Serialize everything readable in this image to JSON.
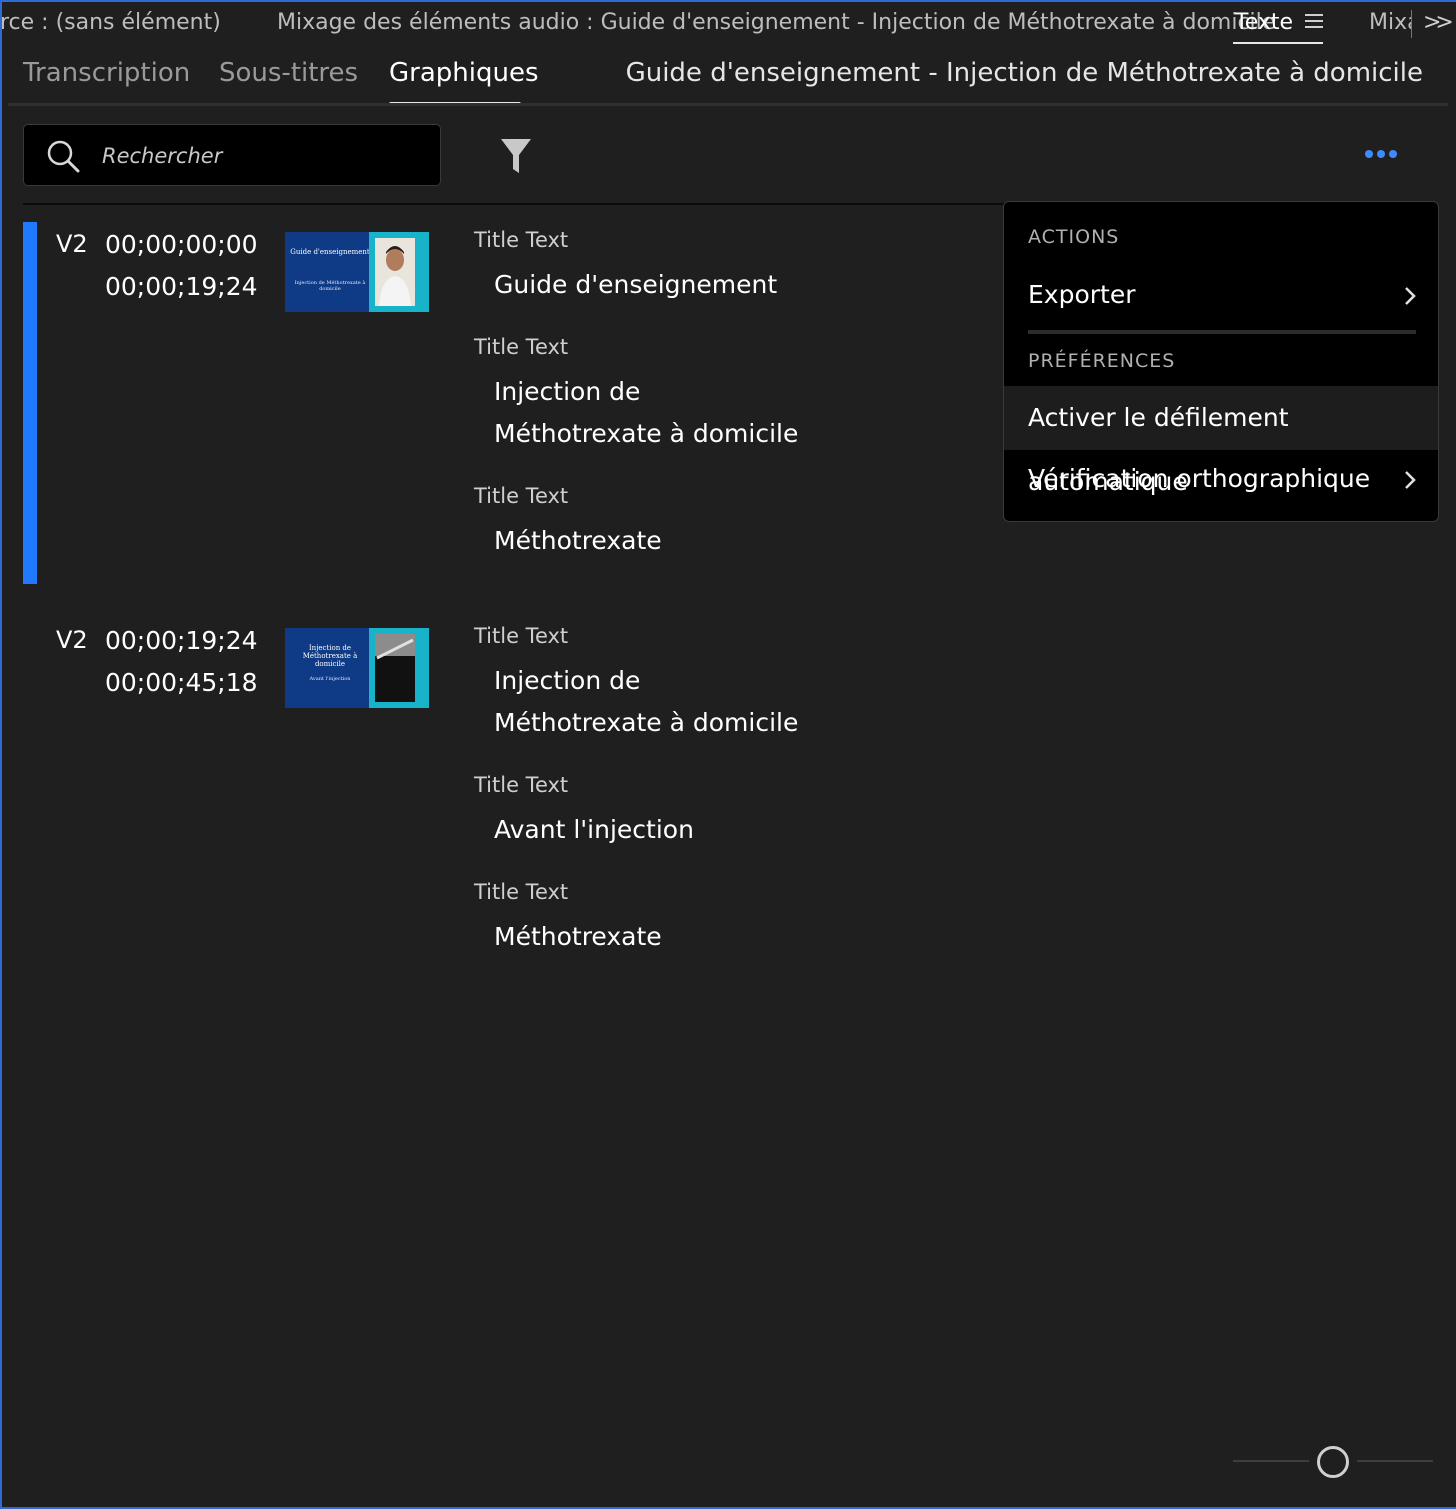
{
  "panel_header": {
    "source_tab": "rce : (sans élément)",
    "mixer_tab": "Mixage des éléments audio : Guide d'enseignement - Injection de Méthotrexate à domicile",
    "text_tab": "Texte",
    "mixer_tab_truncated": "Mixa",
    "overflow_icon": "chevron-double-right-icon",
    "menu_icon": "hamburger-icon"
  },
  "tabs": {
    "transcription": "Transcription",
    "subtitles": "Sous-titres",
    "graphics": "Graphiques",
    "active": "Graphiques"
  },
  "sequence_title": "Guide d'enseignement - Injection de Méthotrexate à domicile",
  "search": {
    "placeholder": "Rechercher",
    "value": "",
    "icon": "search-icon"
  },
  "toolbar": {
    "filter_icon": "filter-icon",
    "more_icon": "more-horizontal-icon"
  },
  "clips": [
    {
      "track": "V2",
      "in": "00;00;00;00",
      "out": "00;00;19;24",
      "selected": true,
      "thumb_title": "Guide d'enseignement",
      "thumb_subtitle": "Injection de Méthotrexate à domicile",
      "items": [
        {
          "label": "Title Text",
          "value": "Guide d'enseignement"
        },
        {
          "label": "Title Text",
          "value": "Injection de Méthotrexate à domicile"
        },
        {
          "label": "Title Text",
          "value": "Méthotrexate"
        }
      ]
    },
    {
      "track": "V2",
      "in": "00;00;19;24",
      "out": "00;00;45;18",
      "selected": false,
      "thumb_title": "Injection de Méthotrexate à domicile",
      "thumb_subtitle": "Avant l'injection",
      "items": [
        {
          "label": "Title Text",
          "value": "Injection de Méthotrexate à domicile"
        },
        {
          "label": "Title Text",
          "value": "Avant l'injection"
        },
        {
          "label": "Title Text",
          "value": "Méthotrexate"
        }
      ]
    }
  ],
  "menu": {
    "actions_heading": "ACTIONS",
    "export": "Exporter",
    "preferences_heading": "PRÉFÉRENCES",
    "auto_scroll": "Activer le défilement automatique",
    "spell_check": "Vérification orthographique"
  },
  "zoom": {
    "level": 0.5
  },
  "colors": {
    "accent": "#1f7aff",
    "background": "#1f1f1f",
    "menu_background": "#000000",
    "thumb_blue": "#0e3a86",
    "thumb_cyan": "#19b3c9"
  }
}
